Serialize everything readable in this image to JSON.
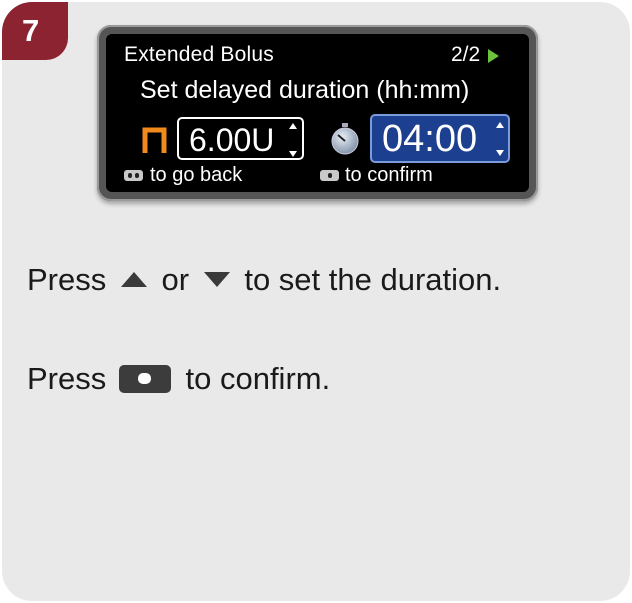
{
  "step": {
    "number": "7"
  },
  "screen": {
    "title": "Extended Bolus",
    "page_indicator": "2/2",
    "subtitle": "Set delayed duration (hh:mm)",
    "amount_value": "6.00U",
    "duration_value": "04:00",
    "back_hint": "to go back",
    "confirm_hint": "to confirm",
    "icons": [
      "next-arrow-icon",
      "extended-bolus-icon",
      "up-down-arrows-icon",
      "timer-icon",
      "device-button-icon"
    ]
  },
  "instructions": {
    "line1_prefix": "Press",
    "line1_or": "or",
    "line1_suffix": "to set the duration.",
    "line2_prefix": "Press",
    "line2_suffix": "to confirm."
  },
  "colors": {
    "badge": "#8b2331",
    "selection": "#1d3f8f",
    "bolus_icon": "#f08a1c",
    "arrow_green": "#6bc23b"
  }
}
